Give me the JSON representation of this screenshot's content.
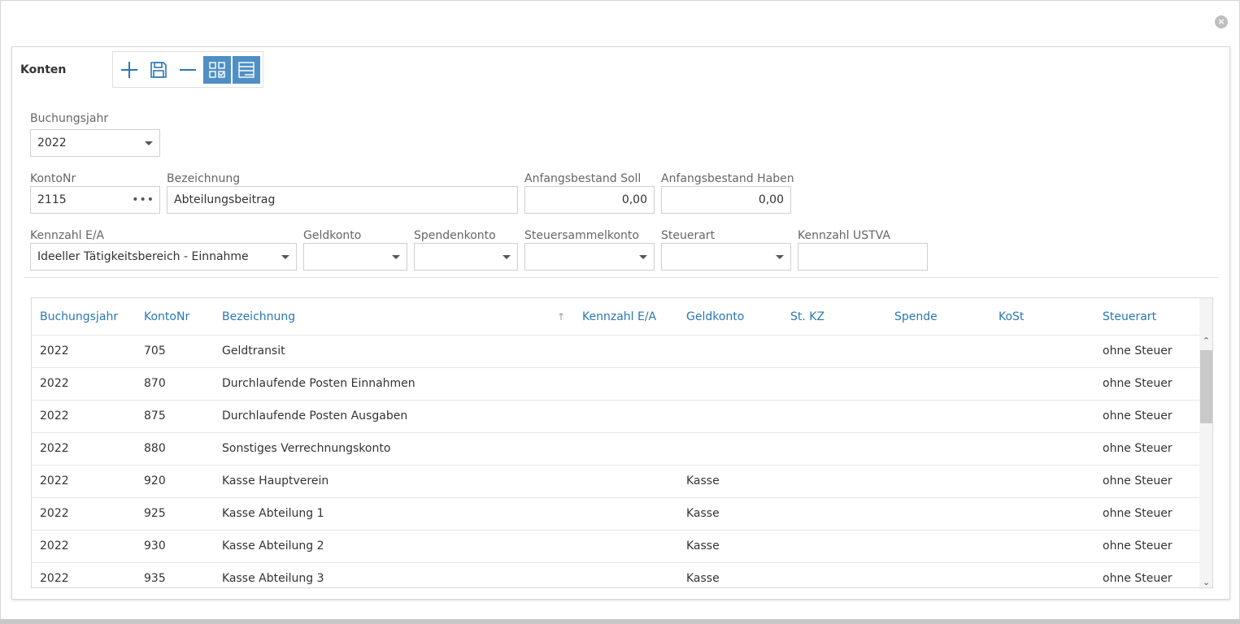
{
  "panel": {
    "title": "Konten",
    "toolbar": {
      "icons": [
        "plus-icon",
        "save-icon",
        "minus-icon",
        "grid-form-icon",
        "list-view-icon"
      ]
    }
  },
  "form": {
    "buchungsjahr": {
      "label": "Buchungsjahr",
      "value": "2022"
    },
    "kontonr": {
      "label": "KontoNr",
      "value": "2115"
    },
    "bezeichnung": {
      "label": "Bezeichnung",
      "value": "Abteilungsbeitrag"
    },
    "anfangsbestand_soll": {
      "label": "Anfangsbestand Soll",
      "value": "0,00"
    },
    "anfangsbestand_haben": {
      "label": "Anfangsbestand Haben",
      "value": "0,00"
    },
    "kennzahl_ea": {
      "label": "Kennzahl E/A",
      "value": "Ideeller Tätigkeitsbereich - Einnahme"
    },
    "geldkonto": {
      "label": "Geldkonto",
      "value": ""
    },
    "spendenkonto": {
      "label": "Spendenkonto",
      "value": ""
    },
    "steuersammelkonto": {
      "label": "Steuersammelkonto",
      "value": ""
    },
    "steuerart": {
      "label": "Steuerart",
      "value": ""
    },
    "kennzahl_ustva": {
      "label": "Kennzahl USTVA",
      "value": ""
    }
  },
  "table": {
    "columns": [
      "Buchungsjahr",
      "KontoNr",
      "Bezeichnung",
      "Kennzahl E/A",
      "Geldkonto",
      "St. KZ",
      "Spende",
      "KoSt",
      "Steuerart"
    ],
    "sort_indicator": "↑",
    "rows": [
      {
        "jahr": "2022",
        "nr": "705",
        "bez": "Geldtransit",
        "geld": "",
        "steuer": "ohne Steuer"
      },
      {
        "jahr": "2022",
        "nr": "870",
        "bez": "Durchlaufende Posten Einnahmen",
        "geld": "",
        "steuer": "ohne Steuer"
      },
      {
        "jahr": "2022",
        "nr": "875",
        "bez": "Durchlaufende Posten Ausgaben",
        "geld": "",
        "steuer": "ohne Steuer"
      },
      {
        "jahr": "2022",
        "nr": "880",
        "bez": "Sonstiges Verrechnungskonto",
        "geld": "",
        "steuer": "ohne Steuer"
      },
      {
        "jahr": "2022",
        "nr": "920",
        "bez": "Kasse Hauptverein",
        "geld": "Kasse",
        "steuer": "ohne Steuer"
      },
      {
        "jahr": "2022",
        "nr": "925",
        "bez": "Kasse Abteilung 1",
        "geld": "Kasse",
        "steuer": "ohne Steuer"
      },
      {
        "jahr": "2022",
        "nr": "930",
        "bez": "Kasse Abteilung 2",
        "geld": "Kasse",
        "steuer": "ohne Steuer"
      },
      {
        "jahr": "2022",
        "nr": "935",
        "bez": "Kasse Abteilung 3",
        "geld": "Kasse",
        "steuer": "ohne Steuer"
      }
    ]
  },
  "colors": {
    "accent": "#2a78b4",
    "toolbar_active": "#4f8fc5"
  }
}
